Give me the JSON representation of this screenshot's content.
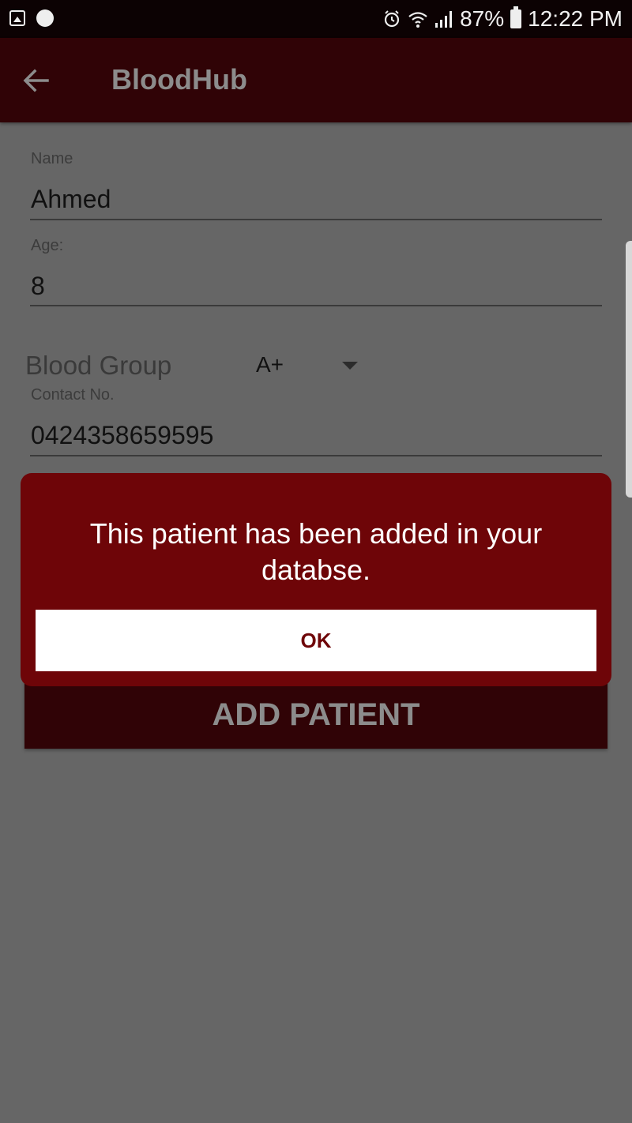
{
  "status_bar": {
    "battery": "87%",
    "time": "12:22 PM",
    "icons": [
      "gallery-icon",
      "circle-icon",
      "alarm-icon",
      "wifi-icon",
      "signal-icon",
      "battery-icon"
    ]
  },
  "app_bar": {
    "title": "BloodHub",
    "back_icon": "arrow-left-icon"
  },
  "form": {
    "name_label": "Name",
    "name_value": "Ahmed",
    "age_label": "Age:",
    "age_value": "8",
    "blood_group_label": "Blood Group",
    "blood_group_value": "A+",
    "contact_label": "Contact No.",
    "contact_value": "0424358659595"
  },
  "add_button_label": "ADD PATIENT",
  "dialog": {
    "message": "This patient has been added in your databse.",
    "ok_label": "OK"
  },
  "colors": {
    "accent": "#6e0508",
    "app_bar": "#300306",
    "scrim_background": "#666666"
  }
}
